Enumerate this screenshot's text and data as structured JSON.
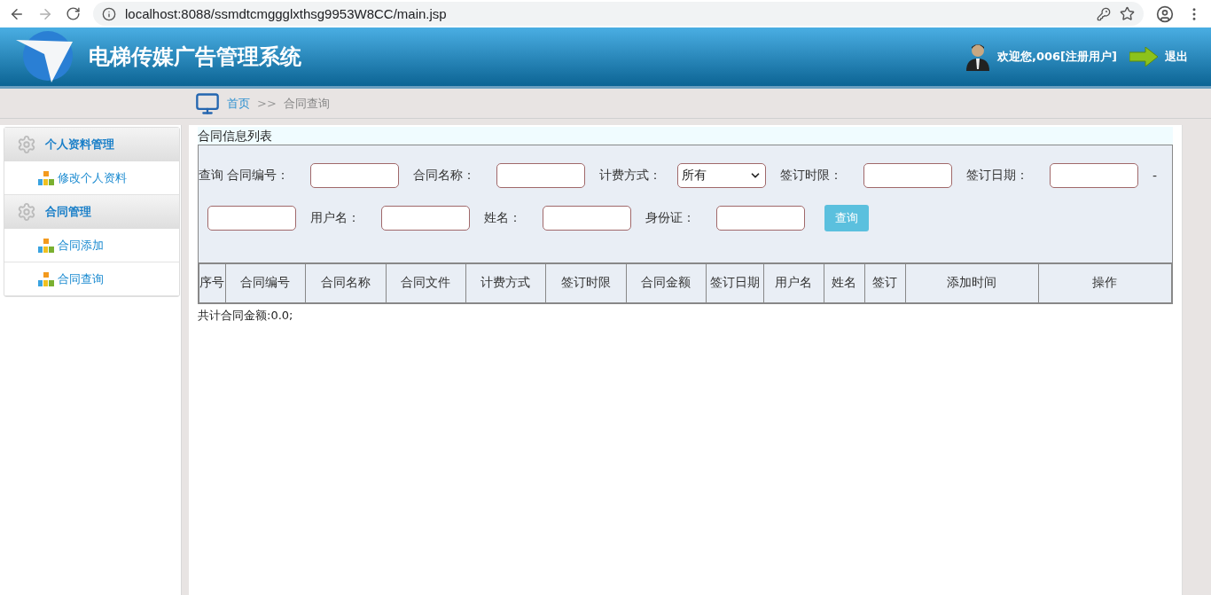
{
  "browser": {
    "url": "localhost:8088/ssmdtcmggglxthsg9953W8CC/main.jsp"
  },
  "header": {
    "title": "电梯传媒广告管理系统",
    "welcome": "欢迎您,006[注册用户]",
    "logout": "退出"
  },
  "breadcrumb": {
    "home": "首页",
    "separator": ">>",
    "current": "合同查询"
  },
  "sidebar": {
    "groups": [
      {
        "title": "个人资料管理",
        "items": [
          "修改个人资料"
        ]
      },
      {
        "title": "合同管理",
        "items": [
          "合同添加",
          "合同查询"
        ]
      }
    ]
  },
  "panel": {
    "title": "合同信息列表",
    "search": {
      "prefix": "查询",
      "fields": [
        {
          "kind": "input",
          "label": "合同编号："
        },
        {
          "kind": "input",
          "label": "合同名称："
        },
        {
          "kind": "select",
          "label": "计费方式：",
          "value": "所有"
        },
        {
          "kind": "input",
          "label": "签订时限："
        },
        {
          "kind": "input",
          "label": "签订日期："
        },
        {
          "kind": "text",
          "text": "-"
        },
        {
          "kind": "input"
        },
        {
          "kind": "input",
          "label": "用户名："
        },
        {
          "kind": "input",
          "label": "姓名："
        },
        {
          "kind": "input",
          "label": "身份证："
        }
      ],
      "button": "查询"
    },
    "table": {
      "columns": [
        "序号",
        "合同编号",
        "合同名称",
        "合同文件",
        "计费方式",
        "签订时限",
        "合同金额",
        "签订日期",
        "用户名",
        "姓名",
        "签订",
        "添加时间",
        "操作"
      ]
    },
    "total": "共计合同金额:0.0;"
  }
}
